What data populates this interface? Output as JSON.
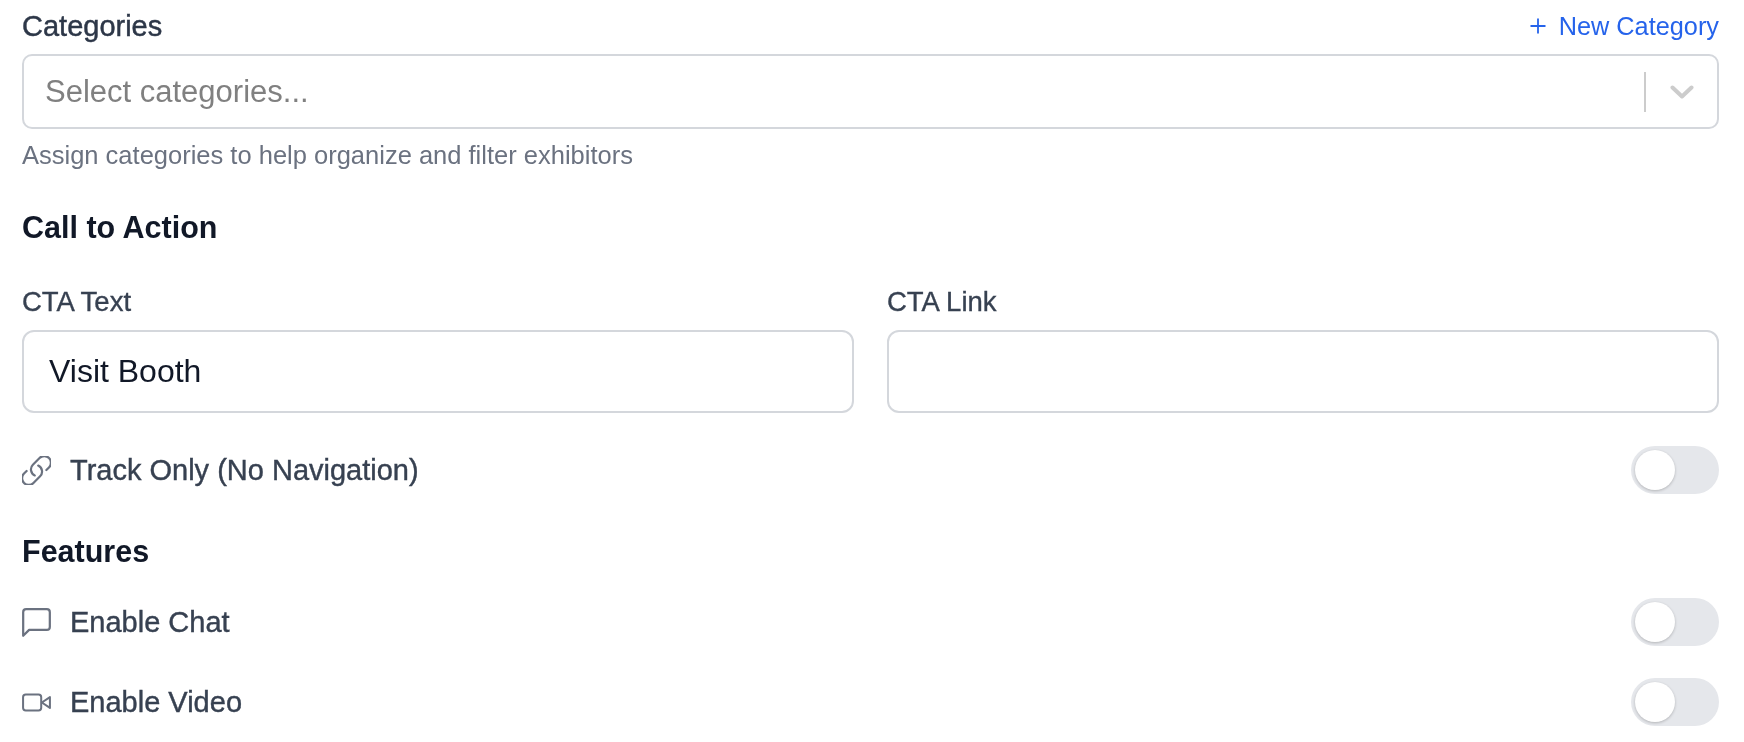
{
  "categories": {
    "label": "Categories",
    "action": "New Category",
    "placeholder": "Select categories...",
    "hint": "Assign categories to help organize and filter exhibitors"
  },
  "call_to_action": {
    "heading": "Call to Action",
    "fields": [
      {
        "label": "CTA Text",
        "value": "Visit Booth"
      },
      {
        "label": "CTA Link"
      }
    ],
    "toggle": {
      "label": "Track Only (No Navigation)",
      "on": false
    }
  },
  "features": {
    "heading": "Features",
    "items": [
      {
        "label": "Enable Chat",
        "on": false
      },
      {
        "label": "Enable Video",
        "on": false
      }
    ]
  }
}
